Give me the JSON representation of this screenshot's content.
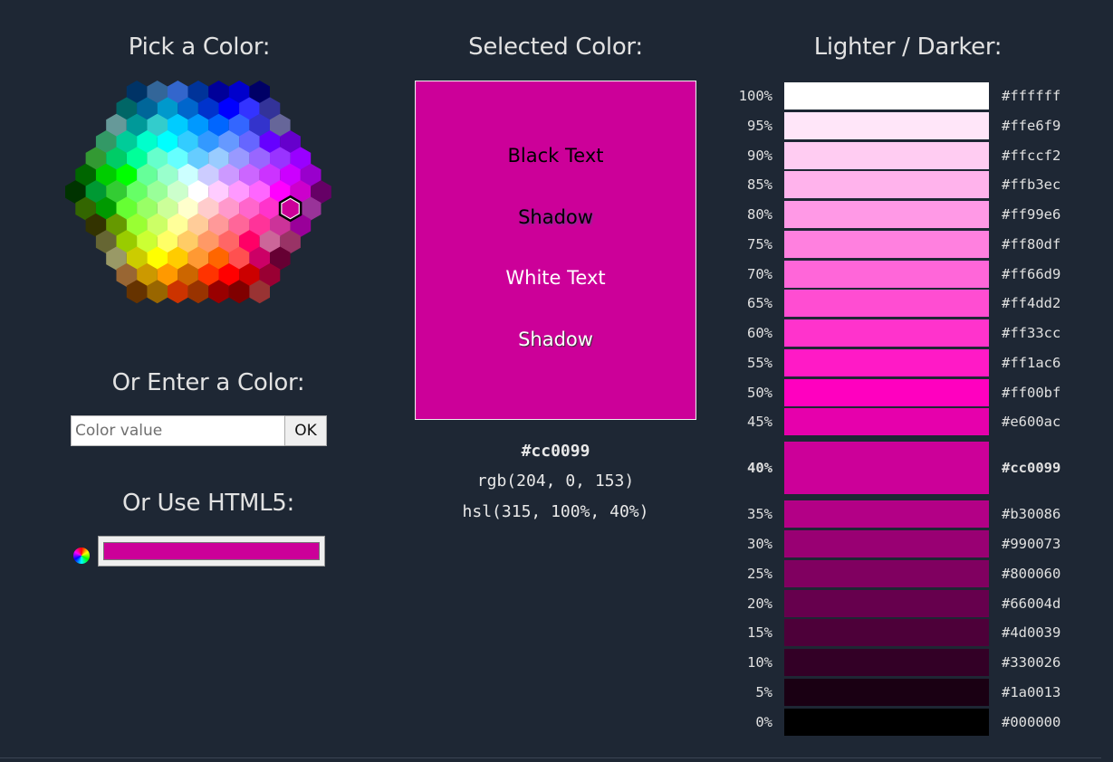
{
  "titles": {
    "pick": "Pick a Color:",
    "selected": "Selected Color:",
    "lighter_darker": "Lighter / Darker:",
    "enter": "Or Enter a Color:",
    "html5": "Or Use HTML5:"
  },
  "color_input": {
    "value": "",
    "placeholder": "Color value"
  },
  "ok_label": "OK",
  "selected": {
    "hex": "#cc0099",
    "rgb": "rgb(204, 0, 153)",
    "hsl": "hsl(315, 100%, 40%)",
    "color": "#cc0099"
  },
  "preview": {
    "black_text": "Black Text",
    "black_shadow": "Shadow",
    "white_text": "White Text",
    "white_shadow": "Shadow"
  },
  "html5_picker": {
    "value": "#cc0099",
    "icon": "color-wheel-icon"
  },
  "hexmap": {
    "selected": "#CC0099",
    "rows": [
      [
        "#003366",
        "#336699",
        "#3366CC",
        "#003399",
        "#000099",
        "#0000CC",
        "#000066"
      ],
      [
        "#006666",
        "#006699",
        "#0099CC",
        "#0066CC",
        "#0033CC",
        "#0000FF",
        "#3333FF",
        "#333399"
      ],
      [
        "#669999",
        "#009999",
        "#33CCCC",
        "#00CCFF",
        "#0099FF",
        "#0066FF",
        "#3366FF",
        "#3333CC",
        "#666699"
      ],
      [
        "#339966",
        "#00CC99",
        "#00FFCC",
        "#00FFFF",
        "#33CCFF",
        "#3399FF",
        "#6699FF",
        "#6666FF",
        "#6600FF",
        "#6600CC"
      ],
      [
        "#339933",
        "#00CC66",
        "#00FF99",
        "#66FFCC",
        "#66FFFF",
        "#66CCFF",
        "#99CCFF",
        "#9999FF",
        "#9966FF",
        "#9933FF",
        "#9900FF"
      ],
      [
        "#006600",
        "#00CC00",
        "#00FF00",
        "#66FF99",
        "#99FFCC",
        "#CCFFFF",
        "#CCCCFF",
        "#CC99FF",
        "#CC66FF",
        "#CC33FF",
        "#CC00FF",
        "#9900CC"
      ],
      [
        "#003300",
        "#009933",
        "#33CC33",
        "#66FF66",
        "#99FF99",
        "#CCFFCC",
        "#FFFFFF",
        "#FFCCFF",
        "#FF99FF",
        "#FF66FF",
        "#FF00FF",
        "#CC00CC",
        "#660066"
      ],
      [
        "#336600",
        "#009900",
        "#66FF33",
        "#99FF66",
        "#CCFF99",
        "#FFFFCC",
        "#FFCCCC",
        "#FF99CC",
        "#FF66CC",
        "#FF33CC",
        "#CC0099",
        "#993399"
      ],
      [
        "#333300",
        "#669900",
        "#99FF33",
        "#CCFF66",
        "#FFFF99",
        "#FFCC99",
        "#FF9999",
        "#FF6699",
        "#FF3399",
        "#CC3399",
        "#990099"
      ],
      [
        "#666633",
        "#99CC00",
        "#CCFF33",
        "#FFFF66",
        "#FFCC66",
        "#FF9966",
        "#FF6666",
        "#FF0066",
        "#CC6699",
        "#993366"
      ],
      [
        "#999966",
        "#CCCC00",
        "#FFFF00",
        "#FFCC00",
        "#FF9933",
        "#FF6600",
        "#FF5050",
        "#CC0066",
        "#660033"
      ],
      [
        "#996633",
        "#CC9900",
        "#FF9900",
        "#CC6600",
        "#FF3300",
        "#FF0000",
        "#CC0000",
        "#990033"
      ],
      [
        "#663300",
        "#996600",
        "#CC3300",
        "#993300",
        "#990000",
        "#800000",
        "#993333"
      ]
    ]
  },
  "shades": [
    {
      "pct": "100%",
      "hex": "#ffffff"
    },
    {
      "pct": "95%",
      "hex": "#ffe6f9"
    },
    {
      "pct": "90%",
      "hex": "#ffccf2"
    },
    {
      "pct": "85%",
      "hex": "#ffb3ec"
    },
    {
      "pct": "80%",
      "hex": "#ff99e6"
    },
    {
      "pct": "75%",
      "hex": "#ff80df"
    },
    {
      "pct": "70%",
      "hex": "#ff66d9"
    },
    {
      "pct": "65%",
      "hex": "#ff4dd2"
    },
    {
      "pct": "60%",
      "hex": "#ff33cc"
    },
    {
      "pct": "55%",
      "hex": "#ff1ac6"
    },
    {
      "pct": "50%",
      "hex": "#ff00bf"
    },
    {
      "pct": "45%",
      "hex": "#e600ac"
    },
    {
      "pct": "40%",
      "hex": "#cc0099",
      "selected": true
    },
    {
      "pct": "35%",
      "hex": "#b30086"
    },
    {
      "pct": "30%",
      "hex": "#990073"
    },
    {
      "pct": "25%",
      "hex": "#800060"
    },
    {
      "pct": "20%",
      "hex": "#66004d"
    },
    {
      "pct": "15%",
      "hex": "#4d0039"
    },
    {
      "pct": "10%",
      "hex": "#330026"
    },
    {
      "pct": "5%",
      "hex": "#1a0013"
    },
    {
      "pct": "0%",
      "hex": "#000000"
    }
  ]
}
